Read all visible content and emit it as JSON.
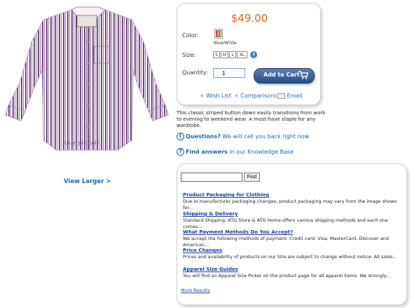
{
  "product": {
    "watermark": "Example only",
    "view_larger": "View Larger >"
  },
  "purchase": {
    "price": "$49.00",
    "color_label": "Color:",
    "color_name": "Blue/White",
    "size_label": "Size:",
    "sizes": [
      "S",
      "M",
      "L",
      "XL"
    ],
    "size_help": "?",
    "quantity_label": "Quantity:",
    "quantity_value": "1",
    "add_to_cart": "Add to Cart",
    "links": {
      "wishlist": "Wish List",
      "comparisons": "Comparisons",
      "email": "Email"
    }
  },
  "description": "This classic striped button down easily transitions from work to evening to weekend wear. A must-have staple for any wardrobe.",
  "help": {
    "questions_bold": "Questions?",
    "questions_rest": " We will call you back right now.",
    "answers_bold": "Find answers",
    "answers_rest": " in our Knowledge Base"
  },
  "search": {
    "input_value": "",
    "find_label": "Find",
    "results": [
      {
        "title": "Product Packaging for Clothing",
        "text": "Due to manufacturer packaging changes, product packaging may vary from the image shown for..."
      },
      {
        "title": "Shipping & Delivery",
        "text": "Standard Shipping: ATG Store & ATG Home offers various shipping methods and each one comes..."
      },
      {
        "title": "What Payment Methods Do You Accept?",
        "text": "We accept the following methods of payment: Credit card: Visa, MasterCard, Discover and American..."
      },
      {
        "title": "Price Changes",
        "text": "Prices and availability of products on our Site are subject to change without notice. All sales..."
      },
      {
        "title": "Apparel Size Guides",
        "text": "You will find an Apparel Size Picker on the product page for all apparel items. We strongly..."
      }
    ],
    "more_results": "More Results"
  },
  "colors": {
    "link": "#1e64b4",
    "price": "#d2691e",
    "button": "#2a4f86"
  }
}
